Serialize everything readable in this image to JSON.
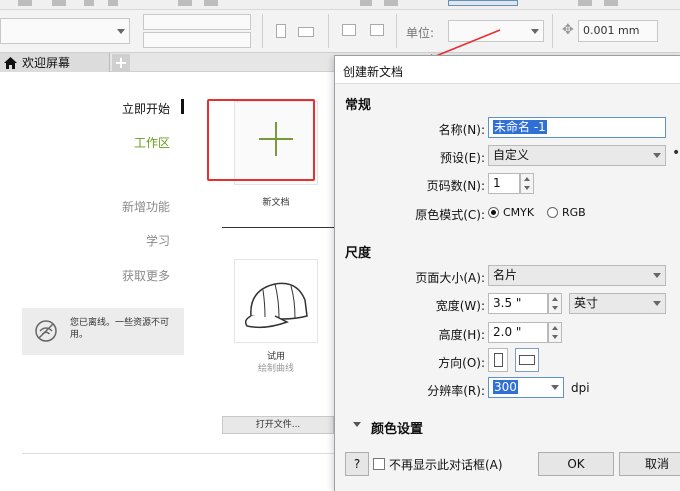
{
  "toolbar": {
    "unit_label": "单位:",
    "nudge_value": "0.001 mm"
  },
  "tabs": {
    "welcome_tab_label": "欢迎屏幕",
    "add_tab_symbol": "+"
  },
  "welcome": {
    "nav": {
      "start": "立即开始",
      "workspace": "工作区",
      "whats_new": "新增功能",
      "learn": "学习",
      "get_more": "获取更多"
    },
    "offline_notice": "您已离线。一些资源不可用。",
    "new_document_label": "新文档",
    "template_title": "试用",
    "template_subtitle": "绘制曲线",
    "open_file_label": "打开文件..."
  },
  "dialog": {
    "title": "创建新文档",
    "general_section": "常规",
    "name_label": "名称(N):",
    "name_value": "未命名 -1",
    "preset_label": "预设(E):",
    "preset_value": "自定义",
    "pages_label": "页码数(N):",
    "pages_value": "1",
    "color_mode_label": "原色模式(C):",
    "color_mode_options": [
      "CMYK",
      "RGB"
    ],
    "color_mode_selected": "CMYK",
    "size_section": "尺度",
    "page_size_label": "页面大小(A):",
    "page_size_value": "名片",
    "width_label": "宽度(W):",
    "width_value": "3.5 \"",
    "unit_value": "英寸",
    "height_label": "高度(H):",
    "height_value": "2.0 \"",
    "orientation_label": "方向(O):",
    "resolution_label": "分辨率(R):",
    "resolution_value": "300",
    "resolution_unit": "dpi",
    "color_settings_label": "颜色设置",
    "help_label": "?",
    "dont_show_label": "不再显示此对话框(A)",
    "ok_label": "OK",
    "cancel_label": "取消"
  },
  "colors": {
    "annotation_red": "#e53030",
    "accent_green": "#6a9a1f",
    "selection_blue": "#2f6fd6"
  }
}
